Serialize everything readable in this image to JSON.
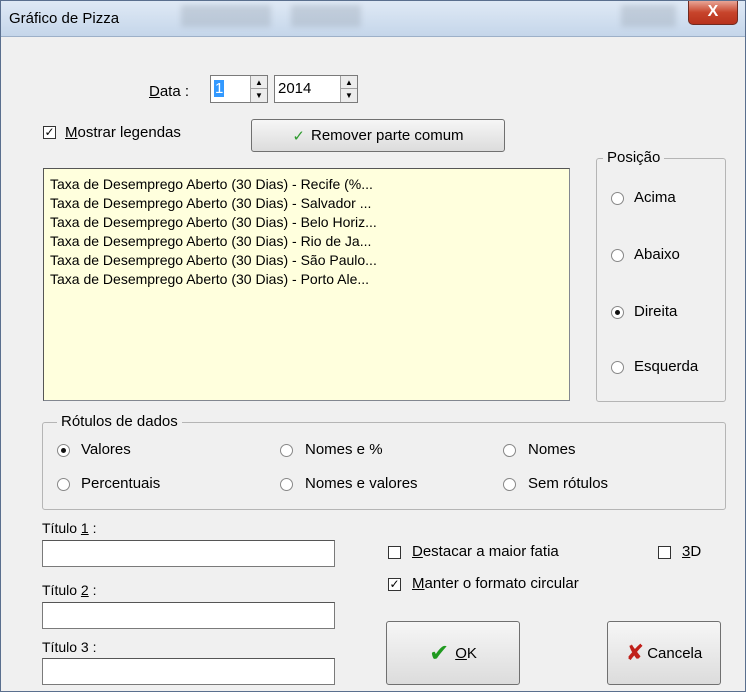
{
  "window": {
    "title": "Gráfico de Pizza",
    "close_glyph": "X"
  },
  "date": {
    "label": "Data :",
    "label_accel": "D",
    "label_rest": "ata :",
    "month": "1",
    "year": "2014"
  },
  "legend_toggle": {
    "accel": "M",
    "label_rest": "ostrar legendas",
    "checked": true
  },
  "remove_common": {
    "label": "Remover parte comum",
    "icon": "check-icon",
    "icon_color": "#2e9b2e"
  },
  "legend_items": [
    "Taxa de Desemprego Aberto (30 Dias) - Recife (%...",
    "Taxa de Desemprego Aberto (30 Dias) - Salvador ...",
    "Taxa de Desemprego Aberto (30 Dias) - Belo Horiz...",
    "Taxa de Desemprego Aberto (30 Dias) - Rio de Ja...",
    "Taxa de Desemprego Aberto (30 Dias) - São Paulo...",
    "Taxa de Desemprego Aberto (30 Dias) - Porto Ale..."
  ],
  "position": {
    "title": "Posição",
    "options": [
      "Acima",
      "Abaixo",
      "Direita",
      "Esquerda"
    ],
    "selected": "Direita"
  },
  "data_labels": {
    "title": "Rótulos de dados",
    "options": [
      "Valores",
      "Nomes e %",
      "Nomes",
      "Percentuais",
      "Nomes e valores",
      "Sem rótulos"
    ],
    "selected": "Valores"
  },
  "titles": {
    "t1_label": "Título 1 :",
    "t1_accel": "1",
    "t2_label": "Título 2 :",
    "t2_accel": "2",
    "t3_label": "Título 3 :",
    "t1_value": "",
    "t2_value": "",
    "t3_value": ""
  },
  "options": {
    "highlight_accel": "D",
    "highlight_rest": "estacar a maior fatia",
    "highlight_checked": false,
    "three_d_accel": "3",
    "three_d_rest": "D",
    "three_d_checked": false,
    "keep_circle_accel": "M",
    "keep_circle_rest": "anter o formato circular",
    "keep_circle_checked": true
  },
  "buttons": {
    "ok_accel": "O",
    "ok_rest": "K",
    "ok_icon": "check-icon",
    "ok_icon_color": "#1f9a1f",
    "cancel_label": "Cancela",
    "cancel_icon": "x-icon",
    "cancel_icon_color": "#c0201a"
  }
}
